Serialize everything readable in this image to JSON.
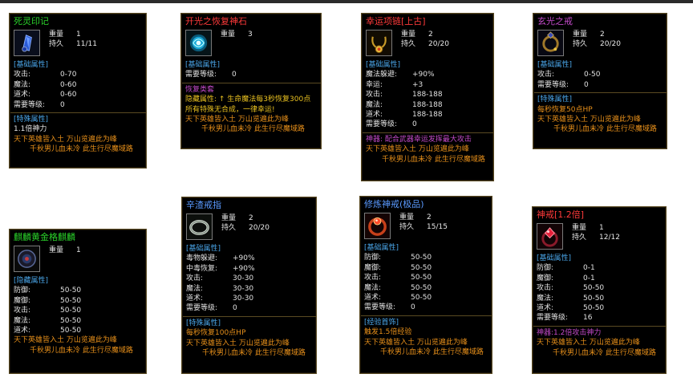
{
  "colors": {
    "bg": "#ffffff",
    "card": "#000000",
    "border": "#5a4a22",
    "section": "#4aa5e8",
    "value": "#e0e0e0",
    "flavor": "#e8901a",
    "green": "#2ad22a",
    "red": "#ff3a3a",
    "purple": "#c24ac8",
    "blue": "#5a9aff"
  },
  "labels": {
    "weight": "重量",
    "durability": "持久"
  },
  "flavor": [
    "天下英雄皆入土 万山览遍此为峰",
    "千秋男儿血未冷 此生行尽魔域路"
  ],
  "cards": [
    {
      "id": "c1",
      "title": "死灵印记",
      "title_color": "#2ad22a",
      "icon": "blue-gem-icon",
      "weight": "1",
      "durability": "11/11",
      "sections": [
        {
          "label": "[基础属性]",
          "attrs": [
            [
              "攻击:",
              "0-70"
            ],
            [
              "魔法:",
              "0-60"
            ],
            [
              "道术:",
              "0-60"
            ],
            [
              "需要等级:",
              "0"
            ]
          ]
        },
        {
          "sep": true,
          "label": "[特殊属性]",
          "notes": [
            {
              "text": "1.1倍神力",
              "color": "#e8e8e8"
            }
          ]
        }
      ]
    },
    {
      "id": "c2",
      "title": "开光之恢复神石",
      "title_color": "#ff3a3a",
      "icon": "cyan-orb-icon",
      "weight": "3",
      "sections": [
        {
          "label": "[基础属性]",
          "attrs": [
            [
              "需要等级:",
              "0"
            ]
          ]
        },
        {
          "sep": true,
          "label": "恢复类套",
          "label_color": "#c24ac8",
          "notes": [
            {
              "text": "隐藏属性: ↑ 生命魔法每3秒恢复300点",
              "color": "#e8c020"
            },
            {
              "text": "所有特殊无合成，一律幸运!",
              "color": "#e8c020"
            }
          ]
        }
      ]
    },
    {
      "id": "c3",
      "title": "幸运项链[上古]",
      "title_color": "#ff3a3a",
      "icon": "gold-necklace-icon",
      "weight": "2",
      "durability": "20/20",
      "sections": [
        {
          "label": "[基础属性]",
          "attrs": [
            [
              "魔法躲避:",
              "+90%"
            ],
            [
              "幸运:",
              "+3"
            ],
            [
              "攻击:",
              "188-188"
            ],
            [
              "魔法:",
              "188-188"
            ],
            [
              "道术:",
              "188-188"
            ],
            [
              "需要等级:",
              "0"
            ]
          ]
        },
        {
          "sep": true,
          "notes": [
            {
              "text": "神器: 配合武器幸运发挥最大攻击",
              "color": "#c24ac8"
            }
          ]
        }
      ]
    },
    {
      "id": "c4",
      "title": "玄光之戒",
      "title_color": "#c24ac8",
      "icon": "dark-ring-icon",
      "weight": "2",
      "durability": "20/20",
      "sections": [
        {
          "label": "[基础属性]",
          "attrs": [
            [
              "攻击:",
              "0-50"
            ],
            [
              "需要等级:",
              "0"
            ]
          ]
        },
        {
          "sep": true,
          "label": "[特殊属性]",
          "notes": [
            {
              "text": "每秒恢复50点HP",
              "color": "#e8901a"
            }
          ]
        }
      ]
    },
    {
      "id": "c5",
      "title": "麒麟黄金格麒麟",
      "title_color": "#2ad22a",
      "icon": "black-orb-icon",
      "weight": "1",
      "sections": [
        {
          "label": "[隐藏属性]",
          "attrs": [
            [
              "防御:",
              "50-50"
            ],
            [
              "魔御:",
              "50-50"
            ],
            [
              "攻击:",
              "50-50"
            ],
            [
              "魔法:",
              "50-50"
            ],
            [
              "道术:",
              "50-50"
            ]
          ]
        }
      ]
    },
    {
      "id": "c6",
      "title": "辛渣戒指",
      "title_color": "#5a9aff",
      "icon": "silver-ring-icon",
      "weight": "2",
      "durability": "20/20",
      "sections": [
        {
          "label": "[基础属性]",
          "attrs": [
            [
              "毒物躲避:",
              "+90%"
            ],
            [
              "中毒恢复:",
              "+90%"
            ],
            [
              "攻击:",
              "30-30"
            ],
            [
              "魔法:",
              "30-30"
            ],
            [
              "道术:",
              "30-30"
            ],
            [
              "需要等级:",
              "0"
            ]
          ]
        },
        {
          "sep": true,
          "label": "[特殊属性]",
          "notes": [
            {
              "text": "每秒恢复100点HP",
              "color": "#e8901a"
            }
          ]
        }
      ]
    },
    {
      "id": "c7",
      "title": "修炼神戒(极品)",
      "title_color": "#5a9aff",
      "icon": "red-ring-icon",
      "weight": "2",
      "durability": "15/15",
      "sections": [
        {
          "label": "[基础属性]",
          "attrs": [
            [
              "防御:",
              "50-50"
            ],
            [
              "魔御:",
              "50-50"
            ],
            [
              "攻击:",
              "50-50"
            ],
            [
              "魔法:",
              "50-50"
            ],
            [
              "道术:",
              "50-50"
            ],
            [
              "需要等级:",
              "0"
            ]
          ]
        },
        {
          "sep": true,
          "label": "[经验首饰]",
          "notes": [
            {
              "text": "触发1.5倍经验",
              "color": "#e8901a"
            }
          ]
        }
      ]
    },
    {
      "id": "c8",
      "title": "神戒[1.2倍]",
      "title_color": "#ff3a3a",
      "icon": "red-gem-ring-icon",
      "weight": "1",
      "durability": "12/12",
      "sections": [
        {
          "label": "[基础属性]",
          "attrs": [
            [
              "防御:",
              "0-1"
            ],
            [
              "魔御:",
              "0-1"
            ],
            [
              "攻击:",
              "50-50"
            ],
            [
              "魔法:",
              "50-50"
            ],
            [
              "道术:",
              "50-50"
            ],
            [
              "需要等级:",
              "16"
            ]
          ]
        },
        {
          "sep": true,
          "notes": [
            {
              "text": "神器:1.2倍攻击神力",
              "color": "#c24ac8"
            }
          ]
        }
      ]
    }
  ]
}
